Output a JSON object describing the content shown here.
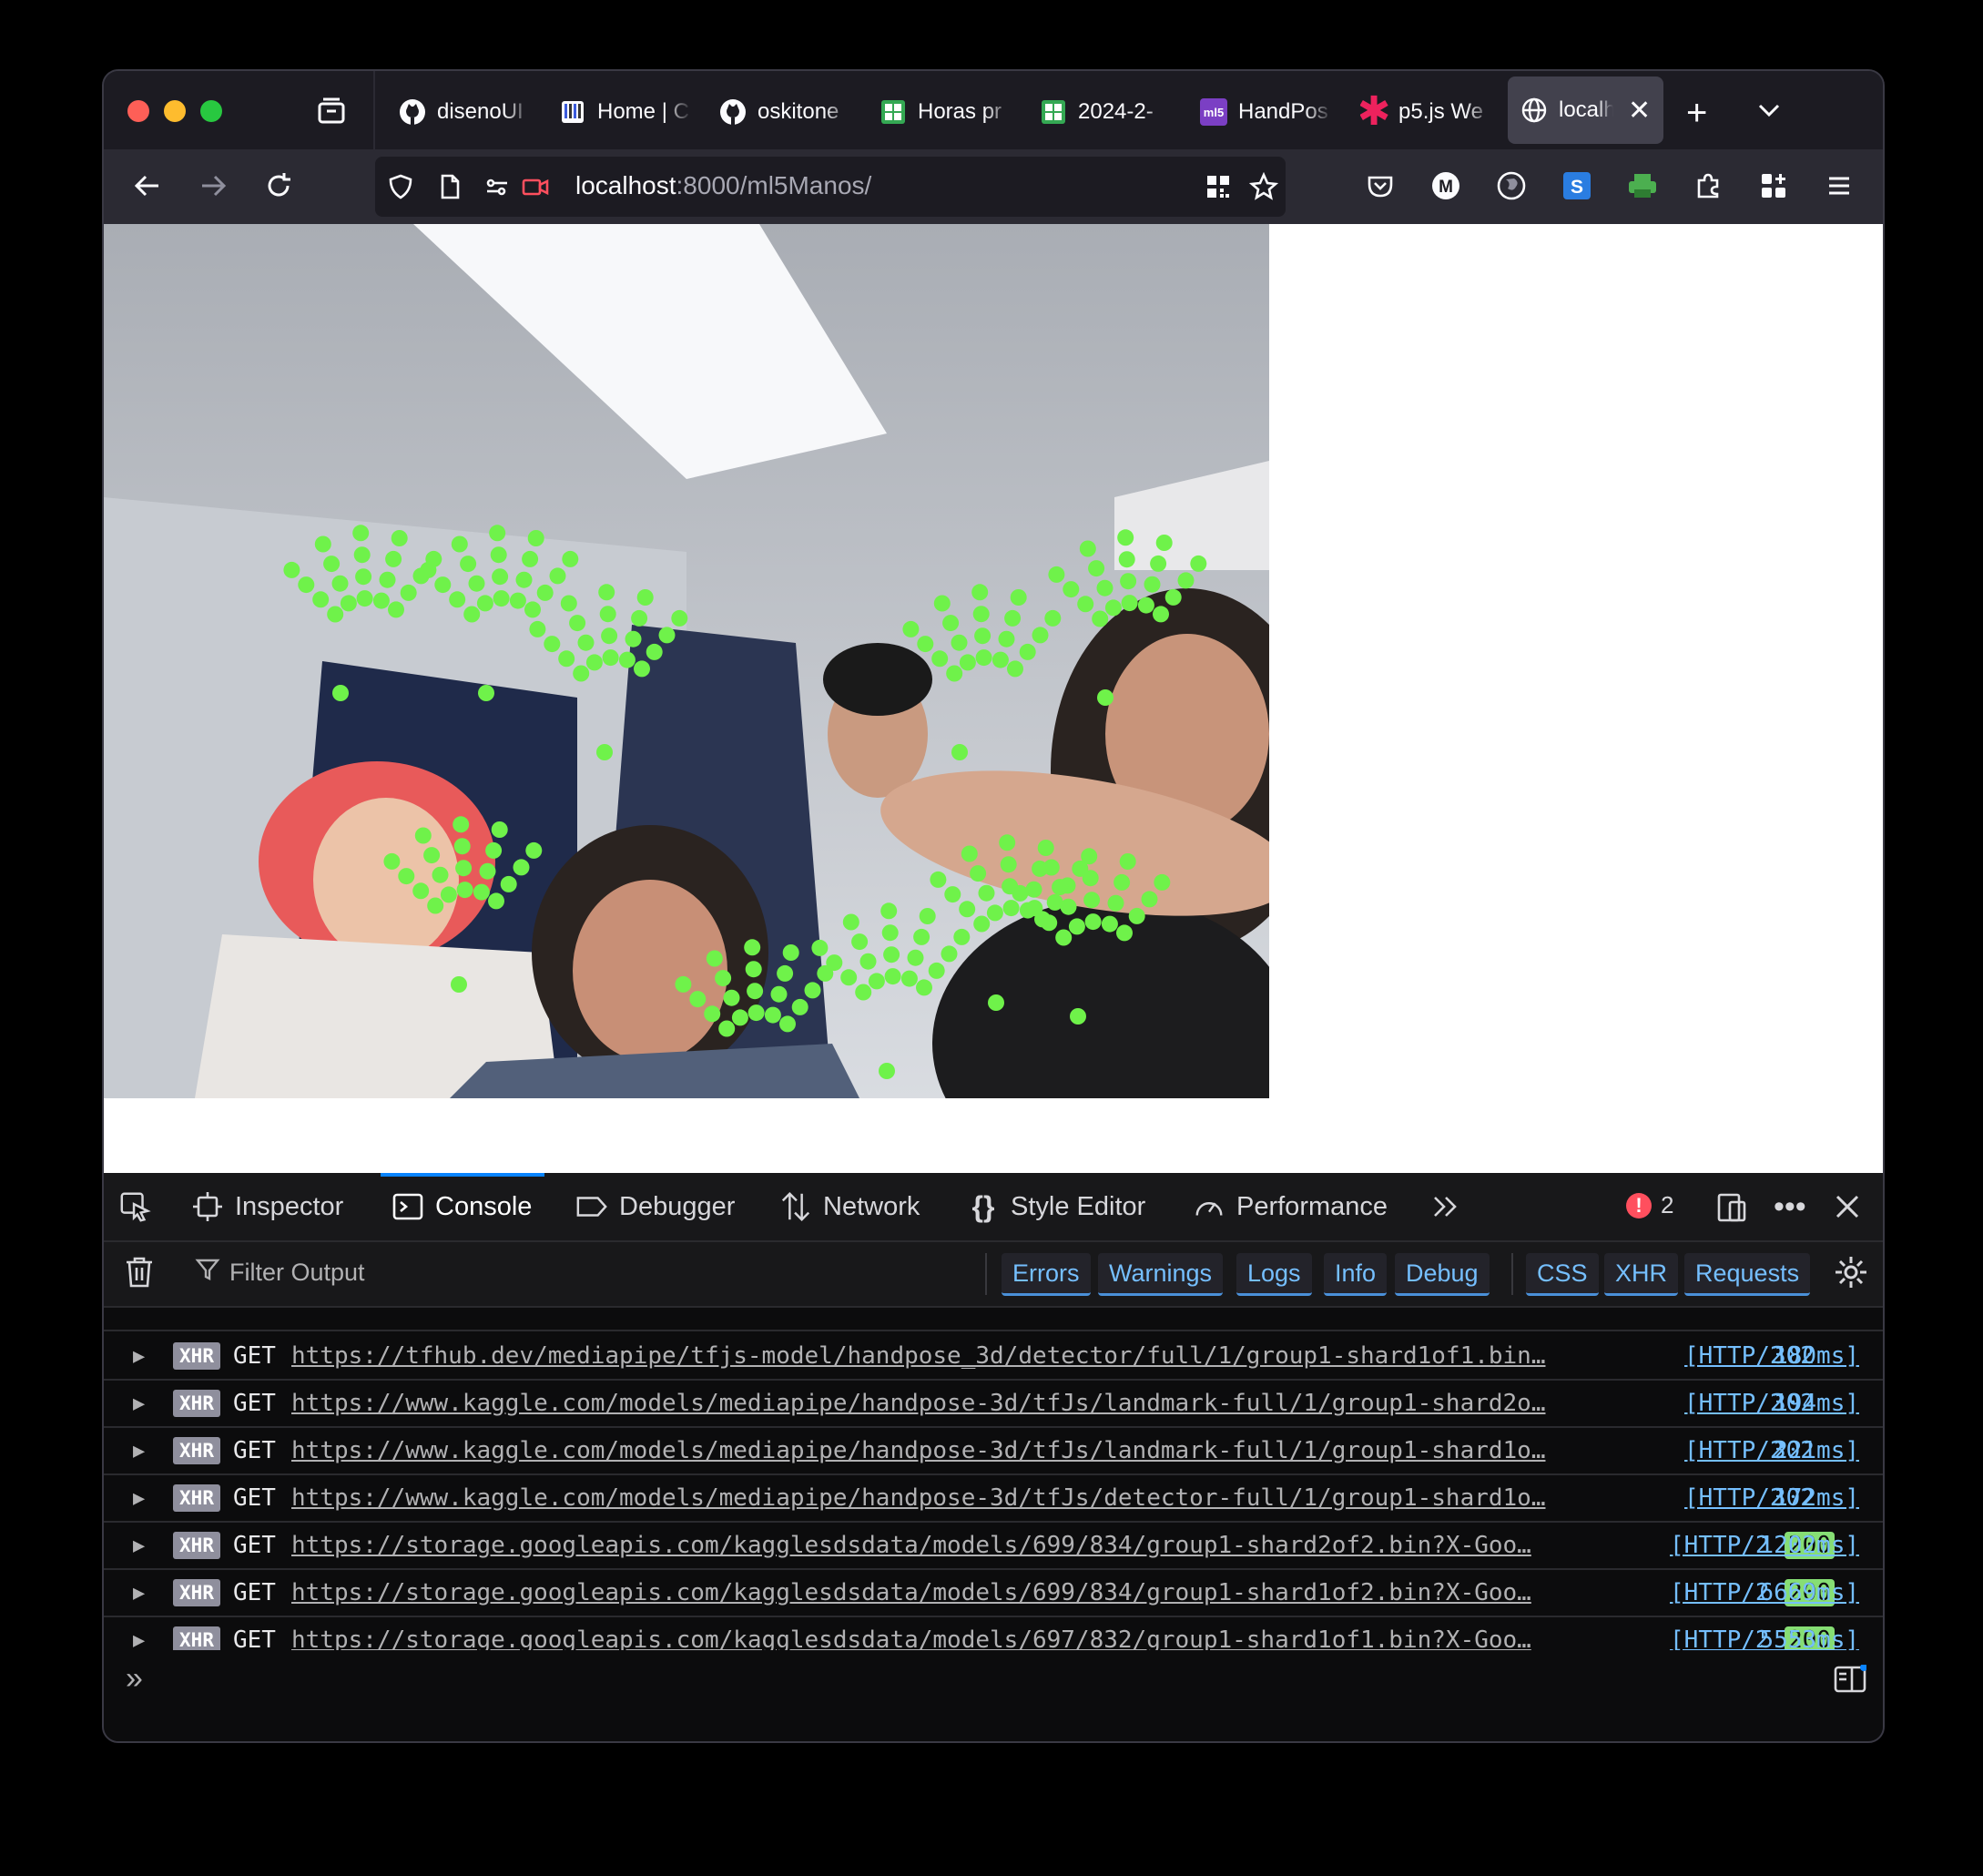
{
  "tabs": [
    {
      "label": "disenoUI",
      "icon": "github-icon"
    },
    {
      "label": "Home | C",
      "icon": "notebook-icon"
    },
    {
      "label": "oskitone",
      "icon": "github-icon"
    },
    {
      "label": "Horas pr",
      "icon": "sheets-icon"
    },
    {
      "label": "2024-2-",
      "icon": "sheets-icon"
    },
    {
      "label": "HandPos",
      "icon": "ml5-icon"
    },
    {
      "label": "p5.js We",
      "icon": "p5-icon"
    },
    {
      "label": "localh",
      "icon": "globe-icon",
      "active": true
    }
  ],
  "ml5_icon_text": "ml5",
  "url": {
    "host": "localhost",
    "rest": ":8000/ml5Manos/"
  },
  "devtools": {
    "tabs": [
      "Inspector",
      "Console",
      "Debugger",
      "Network",
      "Style Editor",
      "Performance"
    ],
    "active_tab": "Console",
    "error_count": "2",
    "filter_placeholder": "Filter Output",
    "filters": [
      "Errors",
      "Warnings",
      "Logs",
      "Info",
      "Debug",
      "CSS",
      "XHR",
      "Requests"
    ]
  },
  "requests": [
    {
      "type": "XHR",
      "method": "GET",
      "url": "https://tfhub.dev/mediapipe/tfjs-model/handpose_3d/detector/full/1/group1-shard1of1.bin…",
      "proto": "[HTTP/2",
      "status": "302",
      "time": "180ms]"
    },
    {
      "type": "XHR",
      "method": "GET",
      "url": "https://www.kaggle.com/models/mediapipe/handpose-3d/tfJs/landmark-full/1/group1-shard2o…",
      "proto": "[HTTP/2",
      "status": "302",
      "time": "194ms]"
    },
    {
      "type": "XHR",
      "method": "GET",
      "url": "https://www.kaggle.com/models/mediapipe/handpose-3d/tfJs/landmark-full/1/group1-shard1o…",
      "proto": "[HTTP/2",
      "status": "302",
      "time": "221ms]"
    },
    {
      "type": "XHR",
      "method": "GET",
      "url": "https://www.kaggle.com/models/mediapipe/handpose-3d/tfJs/detector-full/1/group1-shard1o…",
      "proto": "[HTTP/2",
      "status": "302",
      "time": "172ms]"
    },
    {
      "type": "XHR",
      "method": "GET",
      "url": "https://storage.googleapis.com/kagglesdsdata/models/699/834/group1-shard2of2.bin?X-Goo…",
      "proto": "[HTTP/2",
      "status": "200",
      "time": "1202ms]"
    },
    {
      "type": "XHR",
      "method": "GET",
      "url": "https://storage.googleapis.com/kagglesdsdata/models/699/834/group1-shard1of2.bin?X-Goo…",
      "proto": "[HTTP/2",
      "status": "200",
      "time": "6669ms]"
    },
    {
      "type": "XHR",
      "method": "GET",
      "url": "https://storage.googleapis.com/kagglesdsdata/models/697/832/group1-shard1of1.bin?X-Goo…",
      "proto": "[HTTP/2",
      "status": "200",
      "time": "5553ms]"
    }
  ],
  "colors": {
    "keypoint": "#6ff24a",
    "accent": "#0a84ff",
    "status_ok": "#86de74",
    "link": "#75bfff"
  }
}
